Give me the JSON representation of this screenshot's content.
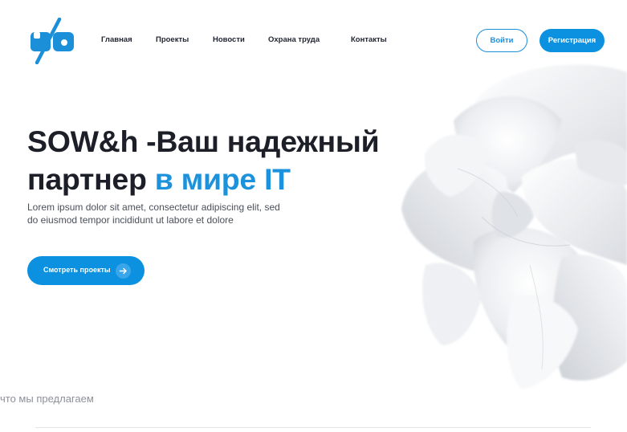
{
  "header": {
    "logo_icon": "brand-logo-icon",
    "nav": [
      {
        "label": "Главная"
      },
      {
        "label": "Проекты"
      },
      {
        "label": "Новости"
      },
      {
        "label": "Охрана труда"
      },
      {
        "label": "Контакты"
      }
    ],
    "login_label": "Войти",
    "register_label": "Регистрация"
  },
  "hero": {
    "title_line1": "SOW&h -Ваш надежный",
    "title_line2_plain": "партнер ",
    "title_line2_accent": "в мире IT",
    "description_line1": "Lorem ipsum dolor sit amet, consectetur adipiscing elit, sed",
    "description_line2": "do eiusmod tempor incididunt ut labore et dolore",
    "cta_label": "Смотреть проекты",
    "cta_icon": "arrow-right-icon"
  },
  "offer": {
    "section_label": "что мы предлагаем"
  },
  "colors": {
    "accent": "#0b91e0",
    "text": "#1c1f27",
    "muted": "#8c9099"
  }
}
